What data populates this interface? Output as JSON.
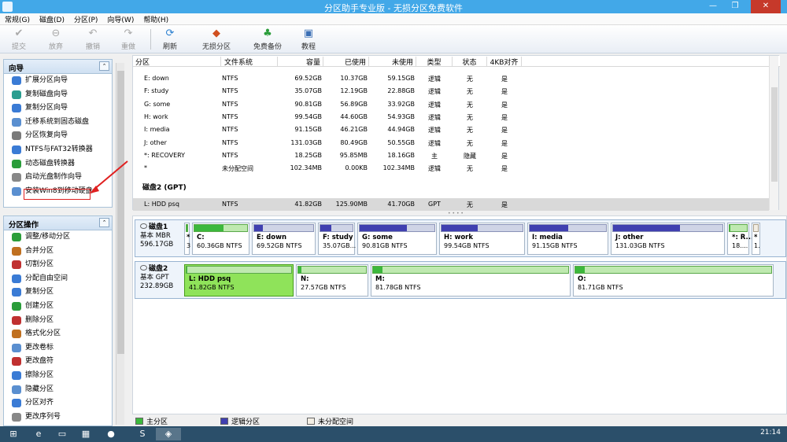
{
  "title": "分区助手专业版 - 无损分区免费软件",
  "window_buttons": {
    "min": "—",
    "max": "❐",
    "close": "✕"
  },
  "menu": [
    "常规(G)",
    "磁盘(D)",
    "分区(P)",
    "向导(W)",
    "帮助(H)"
  ],
  "toolbar": [
    {
      "label": "提交",
      "icon": "commit-icon",
      "enabled": false
    },
    {
      "label": "放弃",
      "icon": "discard-icon",
      "enabled": false
    },
    {
      "label": "撤销",
      "icon": "undo-icon",
      "enabled": false
    },
    {
      "label": "重做",
      "icon": "redo-icon",
      "enabled": false
    },
    {
      "label": "刷新",
      "icon": "refresh-icon",
      "enabled": true
    },
    {
      "label": "无损分区",
      "icon": "lossless-partition-icon",
      "enabled": true
    },
    {
      "label": "免费备份",
      "icon": "free-backup-icon",
      "enabled": true
    },
    {
      "label": "教程",
      "icon": "tutorial-icon",
      "enabled": true
    }
  ],
  "wizard_panel": {
    "title": "向导",
    "items": [
      "扩展分区向导",
      "复制磁盘向导",
      "复制分区向导",
      "迁移系统到固态磁盘",
      "分区恢复向导",
      "NTFS与FAT32转换器",
      "动态磁盘转换器",
      "启动光盘制作向导",
      "安装Win8到移动硬盘"
    ]
  },
  "ops_panel": {
    "title": "分区操作",
    "items": [
      "调整/移动分区",
      "合并分区",
      "切割分区",
      "分配自由空间",
      "复制分区",
      "创建分区",
      "删除分区",
      "格式化分区",
      "更改卷标",
      "更改盘符",
      "擦除分区",
      "隐藏分区",
      "分区对齐",
      "更改序列号"
    ]
  },
  "table": {
    "headers": [
      "分区",
      "文件系统",
      "容量",
      "已使用",
      "未使用",
      "类型",
      "状态",
      "4KB对齐"
    ],
    "rows": [
      [
        "E: down",
        "NTFS",
        "69.52GB",
        "10.37GB",
        "59.15GB",
        "逻辑",
        "无",
        "是"
      ],
      [
        "F: study",
        "NTFS",
        "35.07GB",
        "12.19GB",
        "22.88GB",
        "逻辑",
        "无",
        "是"
      ],
      [
        "G: some",
        "NTFS",
        "90.81GB",
        "56.89GB",
        "33.92GB",
        "逻辑",
        "无",
        "是"
      ],
      [
        "H: work",
        "NTFS",
        "99.54GB",
        "44.60GB",
        "54.93GB",
        "逻辑",
        "无",
        "是"
      ],
      [
        "I: media",
        "NTFS",
        "91.15GB",
        "46.21GB",
        "44.94GB",
        "逻辑",
        "无",
        "是"
      ],
      [
        "J: other",
        "NTFS",
        "131.03GB",
        "80.49GB",
        "50.55GB",
        "逻辑",
        "无",
        "是"
      ],
      [
        "*: RECOVERY",
        "NTFS",
        "18.25GB",
        "95.85MB",
        "18.16GB",
        "主",
        "隐藏",
        "是"
      ],
      [
        "*",
        "未分配空间",
        "102.34MB",
        "0.00KB",
        "102.34MB",
        "逻辑",
        "无",
        "是"
      ]
    ],
    "disk2_title": "磁盘2 (GPT)",
    "disk2_rows": [
      [
        "L: HDD psq",
        "NTFS",
        "41.82GB",
        "125.90MB",
        "41.70GB",
        "GPT",
        "无",
        "是"
      ]
    ]
  },
  "disks": [
    {
      "name": "磁盘1",
      "type": "基本 MBR",
      "size": "596.17GB",
      "partitions": [
        {
          "name": "*",
          "size": "3",
          "kind": "primary"
        },
        {
          "name": "C:",
          "size": "60.36GB NTFS",
          "kind": "primary"
        },
        {
          "name": "E: down",
          "size": "69.52GB NTFS",
          "kind": "logical"
        },
        {
          "name": "F: study",
          "size": "35.07GB...",
          "kind": "logical"
        },
        {
          "name": "G: some",
          "size": "90.81GB NTFS",
          "kind": "logical"
        },
        {
          "name": "H: work",
          "size": "99.54GB NTFS",
          "kind": "logical"
        },
        {
          "name": "I: media",
          "size": "91.15GB NTFS",
          "kind": "logical"
        },
        {
          "name": "J: other",
          "size": "131.03GB NTFS",
          "kind": "logical"
        },
        {
          "name": "*: R...",
          "size": "18....",
          "kind": "primary"
        },
        {
          "name": "*",
          "size": "1.",
          "kind": "unalloc"
        }
      ]
    },
    {
      "name": "磁盘2",
      "type": "基本 GPT",
      "size": "232.89GB",
      "partitions": [
        {
          "name": "L: HDD psq",
          "size": "41.82GB NTFS",
          "kind": "primary"
        },
        {
          "name": "N:",
          "size": "27.57GB NTFS",
          "kind": "primary"
        },
        {
          "name": "M:",
          "size": "81.78GB NTFS",
          "kind": "primary"
        },
        {
          "name": "O:",
          "size": "81.71GB NTFS",
          "kind": "primary"
        }
      ]
    }
  ],
  "legend": [
    "主分区",
    "逻辑分区",
    "未分配空间"
  ],
  "colors": {
    "primary": "#3cb83c",
    "logical": "#4040b0",
    "unalloc": "#f3eee4",
    "selected": "#8fe35a",
    "titlebar": "#42a8e8"
  },
  "taskbar": {
    "time": "21:14"
  }
}
